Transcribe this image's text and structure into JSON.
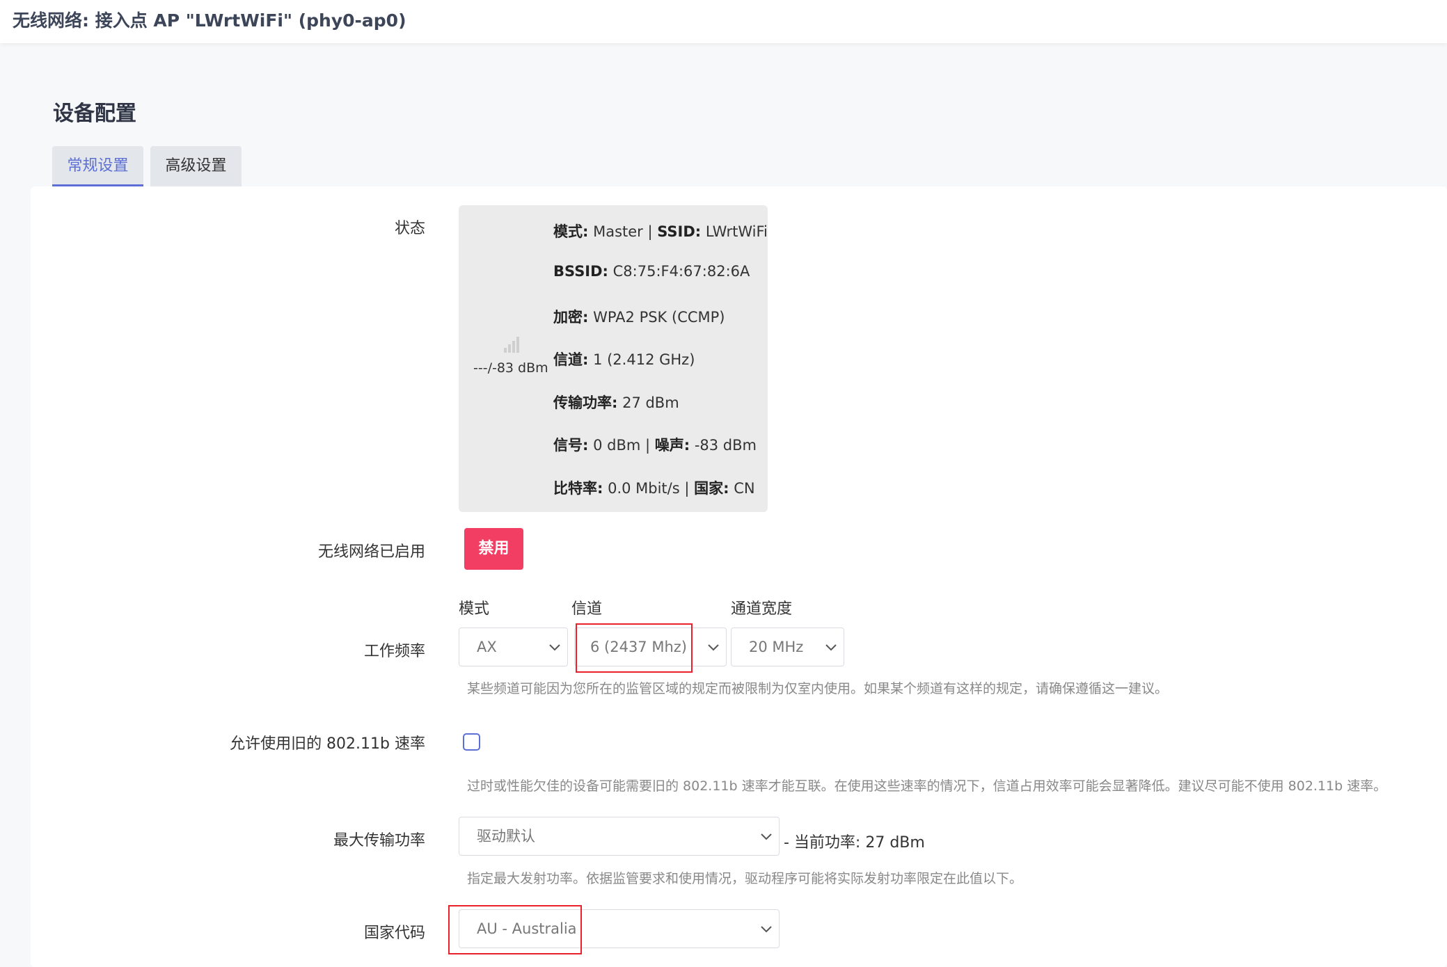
{
  "header": {
    "title": "无线网络: 接入点 AP \"LWrtWiFi\" (phy0-ap0)"
  },
  "section": {
    "title": "设备配置"
  },
  "tabs": [
    {
      "label": "常规设置",
      "active": true
    },
    {
      "label": "高级设置",
      "active": false
    }
  ],
  "status": {
    "label": "状态",
    "signal_icon": "signal-bars-icon",
    "signal_text": "---/-83 dBm",
    "lines": [
      [
        {
          "k": "模式:",
          "v": " Master | "
        },
        {
          "k": "SSID:",
          "v": " LWrtWiFi"
        }
      ],
      [
        {
          "k": "BSSID:",
          "v": " C8:75:F4:67:82:6A"
        }
      ],
      [
        {
          "k": "加密:",
          "v": " WPA2 PSK (CCMP)"
        }
      ],
      [
        {
          "k": "信道:",
          "v": " 1 (2.412 GHz)"
        }
      ],
      [
        {
          "k": "传输功率:",
          "v": " 27 dBm"
        }
      ],
      [
        {
          "k": "信号:",
          "v": " 0 dBm | "
        },
        {
          "k": "噪声:",
          "v": " -83 dBm"
        }
      ],
      [
        {
          "k": "比特率:",
          "v": " 0.0 Mbit/s | "
        },
        {
          "k": "国家:",
          "v": " CN"
        }
      ]
    ]
  },
  "wireless_enabled": {
    "label": "无线网络已启用",
    "button": "禁用"
  },
  "frequency": {
    "label": "工作频率",
    "mode_head": "模式",
    "channel_head": "信道",
    "width_head": "通道宽度",
    "mode": "AX",
    "channel": "6 (2437 Mhz)",
    "width": "20 MHz",
    "hint": "某些频道可能因为您所在的监管区域的规定而被限制为仅室内使用。如果某个频道有这样的规定，请确保遵循这一建议。"
  },
  "legacy": {
    "label": "允许使用旧的 802.11b 速率",
    "checked": false,
    "hint": "过时或性能欠佳的设备可能需要旧的 802.11b 速率才能互联。在使用这些速率的情况下，信道占用效率可能会显著降低。建议尽可能不使用 802.11b 速率。"
  },
  "txpower": {
    "label": "最大传输功率",
    "value": "驱动默认",
    "current": "- 当前功率: 27 dBm",
    "hint": "指定最大发射功率。依据监管要求和使用情况，驱动程序可能将实际发射功率限定在此值以下。"
  },
  "country": {
    "label": "国家代码",
    "value": "AU - Australia"
  },
  "colors": {
    "accent": "#5b6fd6",
    "danger": "#f23e63",
    "highlight": "#e8212c"
  }
}
